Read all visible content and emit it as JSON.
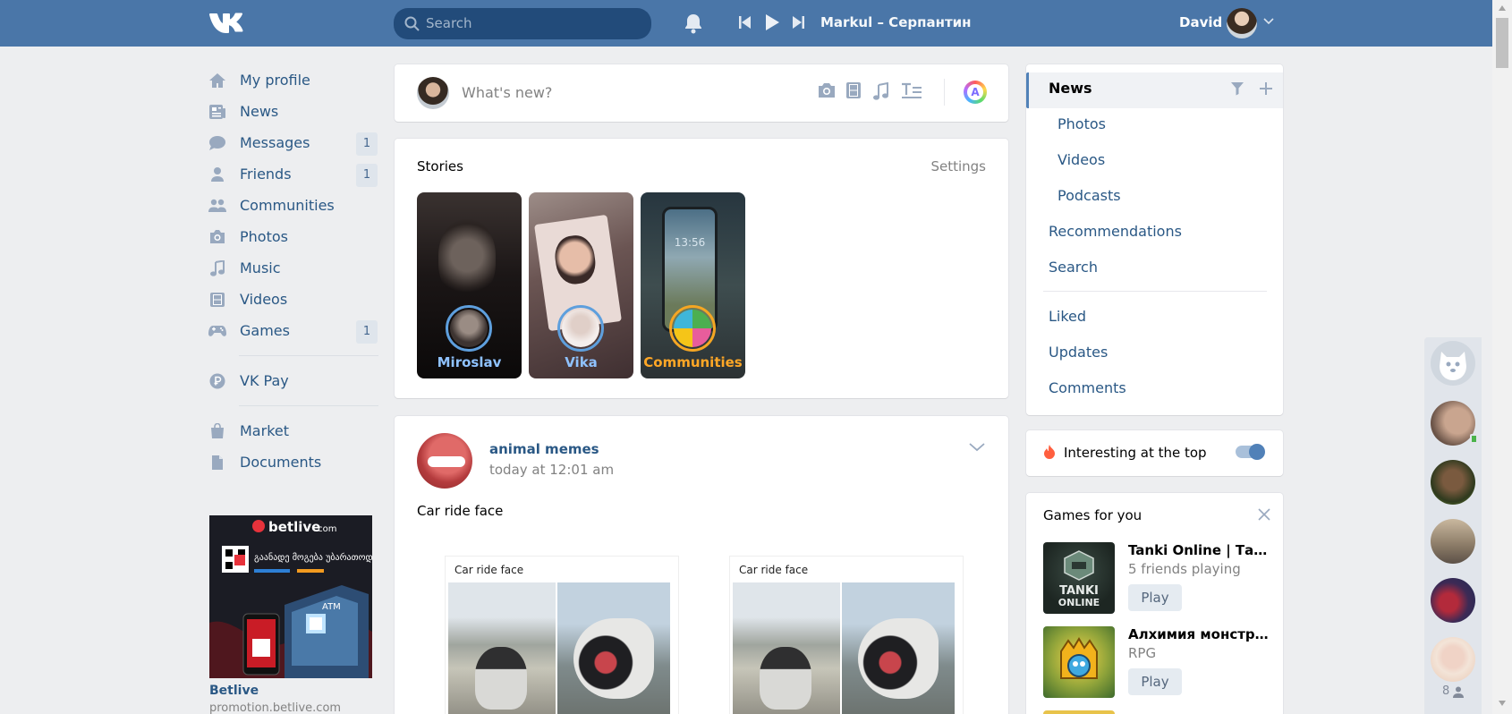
{
  "header": {
    "search_placeholder": "Search",
    "track": "Markul – Серпантин",
    "user_name": "David"
  },
  "nav": {
    "items": [
      {
        "label": "My profile",
        "icon": "home-icon"
      },
      {
        "label": "News",
        "icon": "news-icon"
      },
      {
        "label": "Messages",
        "icon": "messages-icon",
        "count": "1"
      },
      {
        "label": "Friends",
        "icon": "friend-icon",
        "count": "1"
      },
      {
        "label": "Communities",
        "icon": "communities-icon"
      },
      {
        "label": "Photos",
        "icon": "camera-icon"
      },
      {
        "label": "Music",
        "icon": "music-icon"
      },
      {
        "label": "Videos",
        "icon": "film-icon"
      },
      {
        "label": "Games",
        "icon": "gamepad-icon",
        "count": "1"
      }
    ],
    "vkpay": "VK Pay",
    "market": "Market",
    "documents": "Documents",
    "ad": {
      "brand": "betlive",
      "brand_suffix": ".com",
      "georgian": "გაანადე მოგება უბარათოდ",
      "atm": "ATM",
      "title": "Betlive",
      "subtitle": "promotion.betlive.com"
    }
  },
  "composer": {
    "placeholder": "What's new?",
    "avatar_letter": "A"
  },
  "stories": {
    "title": "Stories",
    "settings": "Settings",
    "items": [
      {
        "name": "Miroslav"
      },
      {
        "name": "Vika"
      },
      {
        "name": "Communities",
        "clock": "13:56"
      }
    ]
  },
  "post": {
    "author": "animal memes",
    "time": "today at 12:01 am",
    "text": "Car ride face",
    "image_caption": "Car ride face"
  },
  "feed_filter": {
    "items": [
      {
        "label": "News",
        "active": true
      },
      {
        "label": "Photos"
      },
      {
        "label": "Videos"
      },
      {
        "label": "Podcasts"
      },
      {
        "label": "Recommendations"
      },
      {
        "label": "Search"
      },
      {
        "label": "Liked"
      },
      {
        "label": "Updates"
      },
      {
        "label": "Comments"
      }
    ]
  },
  "interesting": {
    "label": "Interesting at the top",
    "enabled": true
  },
  "games": {
    "title": "Games for you",
    "items": [
      {
        "name": "Tanki Online | Танки Онлайн",
        "sub": "5 friends playing",
        "play": "Play",
        "logo_line1": "TANKI",
        "logo_line2": "ONLINE"
      },
      {
        "name": "Алхимия монстров",
        "sub": "RPG",
        "play": "Play"
      }
    ]
  },
  "chat": {
    "online_count": "8"
  },
  "colors": {
    "header": "#4a76a8",
    "link": "#2a5885",
    "background": "#edeef0"
  }
}
